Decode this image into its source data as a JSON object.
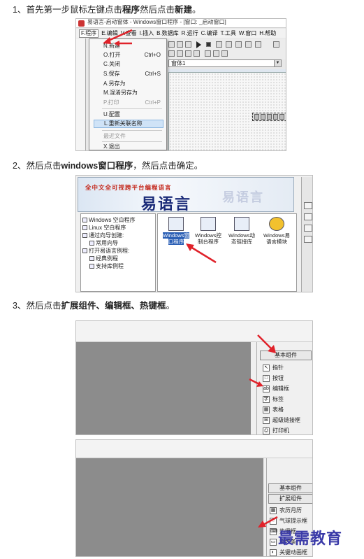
{
  "steps": [
    {
      "num": "1、",
      "pre": "首先第一步鼠标左键点击",
      "b1": "程序",
      "mid": "然后点击",
      "b2": "新建",
      "post": "。"
    },
    {
      "num": "2、",
      "pre": "然后点击",
      "b1": "windows窗口程序",
      "post": "，然后点击确定。"
    },
    {
      "num": "3、",
      "pre": "然后点击",
      "b1": "扩展组件、编辑框、热键框",
      "post": "。"
    }
  ],
  "shot1": {
    "title": "易语言-启动窗体 - Windows窗口程序 - [窗口: _启动窗口]",
    "menubar": [
      "F.程序",
      "E.编辑",
      "V.查看",
      "I.插入",
      "B.数据库",
      "R.运行",
      "C.编译",
      "T.工具",
      "W.窗口",
      "H.帮助"
    ],
    "combo_value": "窗体1",
    "menu_items": [
      {
        "label": "N.新建",
        "shortcut": ""
      },
      {
        "label": "O.打开",
        "shortcut": "Ctrl+O"
      },
      {
        "label": "C.关闭",
        "shortcut": ""
      },
      {
        "label": "S.保存",
        "shortcut": "Ctrl+S"
      },
      {
        "label": "A.另存为",
        "shortcut": ""
      },
      {
        "label": "M.混淆另存为",
        "shortcut": ""
      },
      {
        "label": "P.打印",
        "shortcut": "Ctrl+P"
      },
      {
        "label": "U.配置",
        "shortcut": ""
      },
      {
        "label": "L.重新关联名称",
        "shortcut": ""
      },
      {
        "label": "最近文件",
        "shortcut": ""
      },
      {
        "label": "X.退出",
        "shortcut": ""
      }
    ]
  },
  "shot2": {
    "slogan": "全中文全可视跨平台编程语言",
    "brand": "易语言",
    "tree": [
      "Windows 空白程序",
      "Linux 空白程序",
      "通过向导创建:",
      "常用向导",
      "打开易语言例程:",
      "经典例程",
      "支持库例程"
    ],
    "items": [
      "Windows窗口程序",
      "Windows控制台程序",
      "Windows动态链接库",
      "Windows易语言模块"
    ]
  },
  "shot3": {
    "tab_basic": "基本组件",
    "tools": [
      "指针",
      "按钮",
      "编辑框",
      "标签",
      "表格",
      "超级链接框",
      "打印机"
    ],
    "tool_glyphs": [
      "↖",
      "□",
      "ab",
      "字",
      "▦",
      "⊞",
      "⎙"
    ]
  },
  "shot4": {
    "tab_basic": "基本组件",
    "tab_ext": "扩展组件",
    "tools": [
      "农历月历",
      "气球提示框",
      "热键框",
      "滑块条",
      "关键动画框"
    ],
    "tool_glyphs": [
      "▦",
      "◌",
      "⌨",
      "▭",
      "◐"
    ]
  },
  "watermark": "最需教育",
  "colors": {
    "arrow": "#e0222a",
    "highlight": "#cfe3f7",
    "brand": "#1a2a78",
    "slogan": "#c4281c"
  }
}
